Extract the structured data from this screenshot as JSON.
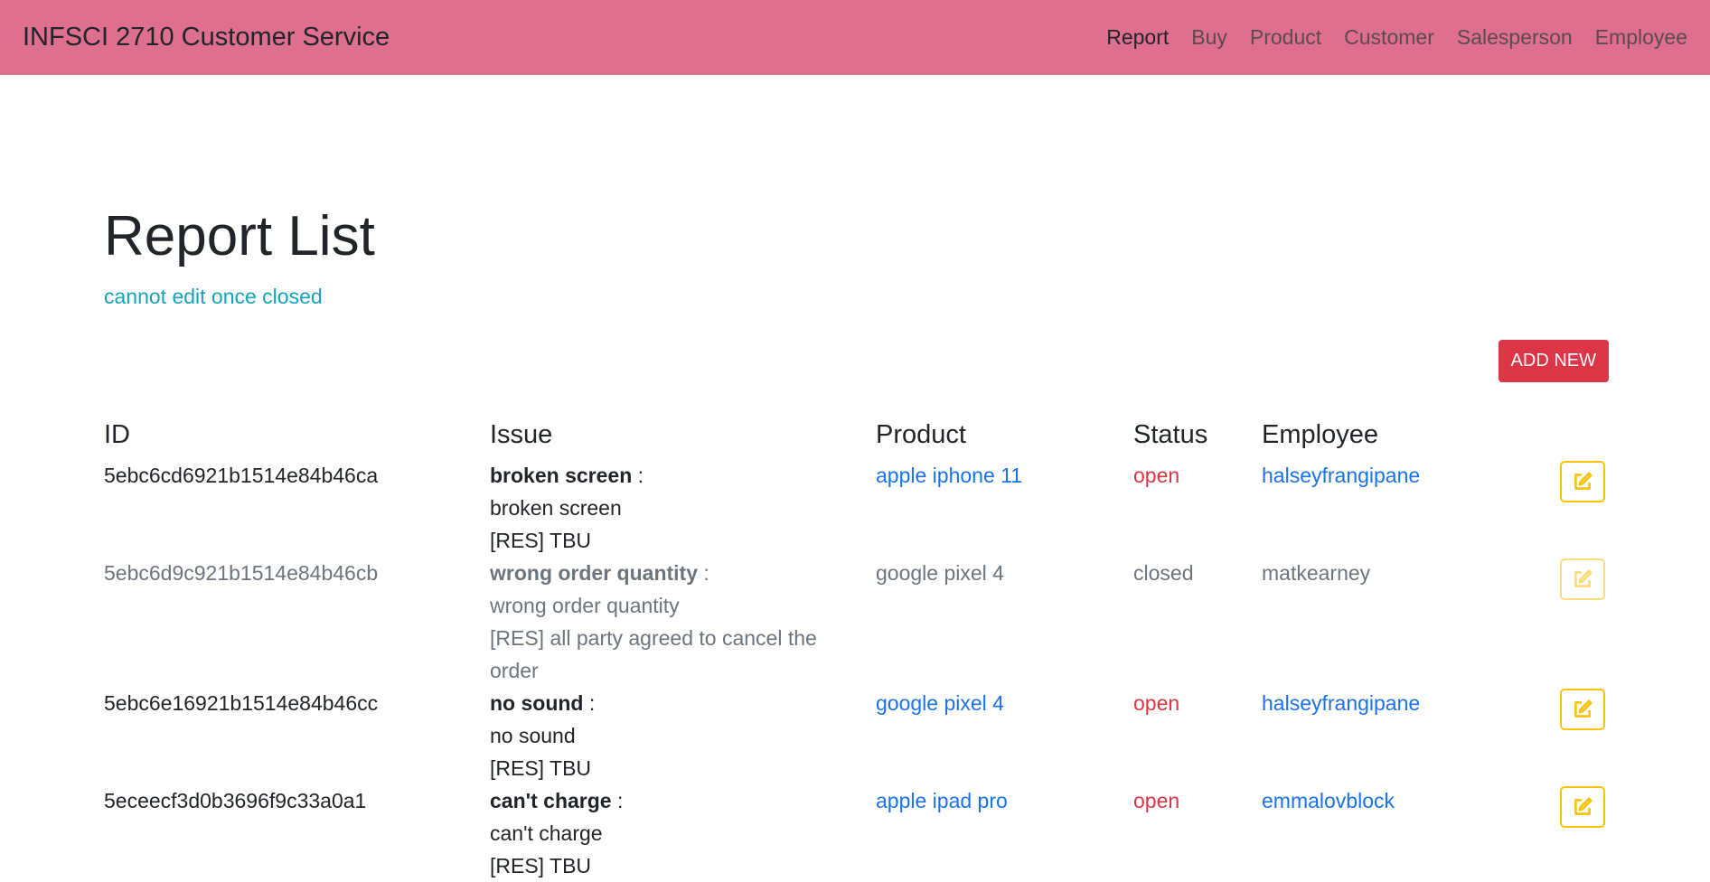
{
  "navbar": {
    "brand": "INFSCI 2710 Customer Service",
    "links": [
      "Report",
      "Buy",
      "Product",
      "Customer",
      "Salesperson",
      "Employee"
    ],
    "active": "Report"
  },
  "page": {
    "title": "Report List",
    "note": "cannot edit once closed",
    "add_button": "ADD NEW"
  },
  "table": {
    "headers": [
      "ID",
      "Issue",
      "Product",
      "Status",
      "Employee"
    ],
    "rows": [
      {
        "id": "5ebc6cd6921b1514e84b46ca",
        "issue_title": "broken screen",
        "issue_desc": "broken screen",
        "resolution": "[RES] TBU",
        "product": "apple iphone 11",
        "status": "open",
        "employee": "halseyfrangipane"
      },
      {
        "id": "5ebc6d9c921b1514e84b46cb",
        "issue_title": "wrong order quantity",
        "issue_desc": "wrong order quantity",
        "resolution": "[RES] all party agreed to cancel the order",
        "product": "google pixel 4",
        "status": "closed",
        "employee": "matkearney"
      },
      {
        "id": "5ebc6e16921b1514e84b46cc",
        "issue_title": "no sound",
        "issue_desc": "no sound",
        "resolution": "[RES] TBU",
        "product": "google pixel 4",
        "status": "open",
        "employee": "halseyfrangipane"
      },
      {
        "id": "5eceecf3d0b3696f9c33a0a1",
        "issue_title": "can't charge",
        "issue_desc": "can't charge",
        "resolution": "[RES] TBU",
        "product": "apple ipad pro",
        "status": "open",
        "employee": "emmalovblock"
      }
    ]
  },
  "colors": {
    "navbar": "#de6f8f",
    "link": "#1a73e8",
    "open": "#dc3545",
    "closed": "#28a745",
    "edit_border": "#ffc107",
    "note": "#17a2b8"
  },
  "icons": {
    "edit": "edit-icon"
  }
}
